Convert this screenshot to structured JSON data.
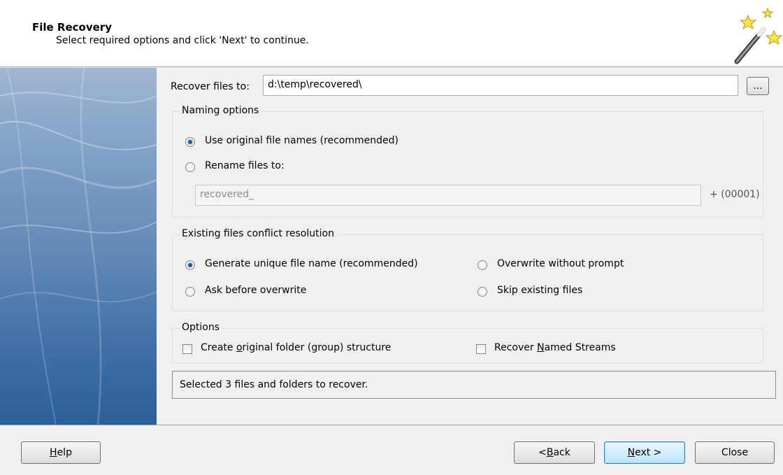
{
  "header": {
    "title": "File Recovery",
    "subtitle": "Select required options and click 'Next' to continue."
  },
  "recover_to": {
    "label": "Recover files to:",
    "value": "d:\\temp\\recovered\\",
    "browse_label": "..."
  },
  "naming": {
    "title": "Naming options",
    "options": [
      {
        "label": "Use original file names (recommended)",
        "selected": true
      },
      {
        "label": "Rename files to:",
        "selected": false
      }
    ],
    "rename_value": "recovered_",
    "suffix": "+ (00001)"
  },
  "conflict": {
    "title": "Existing files conflict resolution",
    "options": [
      {
        "label": "Generate unique file name (recommended)",
        "selected": true
      },
      {
        "label": "Overwrite without prompt",
        "selected": false
      },
      {
        "label": "Ask before overwrite",
        "selected": false
      },
      {
        "label": "Skip existing files",
        "selected": false
      }
    ]
  },
  "options": {
    "title": "Options",
    "create_folder_pre": "Create ",
    "create_folder_mnemonic": "o",
    "create_folder_post": "riginal folder (group) structure",
    "create_folder_checked": false,
    "named_streams_pre": "Recover ",
    "named_streams_mnemonic": "N",
    "named_streams_post": "amed Streams",
    "named_streams_checked": false
  },
  "status_text": "Selected 3 files and folders to recover.",
  "footer": {
    "help_mnemonic": "H",
    "help_rest": "elp",
    "back_pre": "< ",
    "back_mnemonic": "B",
    "back_rest": "ack",
    "next_mnemonic": "N",
    "next_rest": "ext >",
    "close_label": "Close"
  },
  "colors": {
    "radio_selected": "#1e5aa8",
    "default_button": "#bee6fd",
    "banner_dark": "#2c5f98"
  }
}
